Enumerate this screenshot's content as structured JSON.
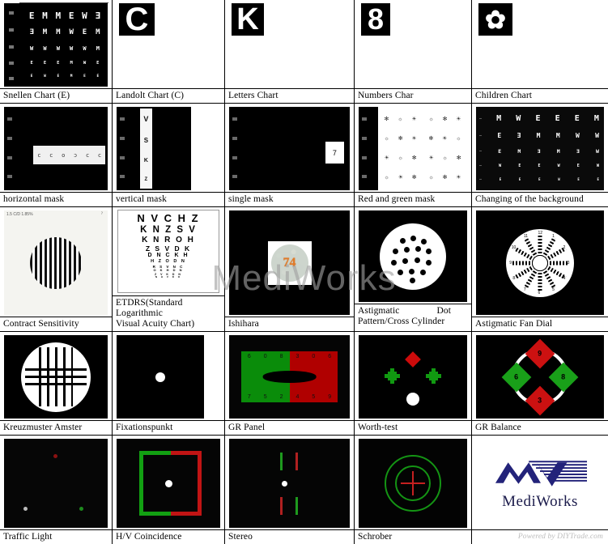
{
  "brand": {
    "name": "MediWorks",
    "watermark": "MediWorks",
    "powered_by": "Powered by DIYTrade.com",
    "logo_color": "#23237a"
  },
  "grid": {
    "columns": 5,
    "rows": 5,
    "cells": [
      {
        "caption": "Snellen Chart (E)",
        "art": "snellen-e-chart",
        "glyph": "E"
      },
      {
        "caption": "Landolt Chart (C)",
        "art": "landolt-c-tile",
        "glyph": "C"
      },
      {
        "caption": "Letters Chart",
        "art": "letter-tile",
        "glyph": "K"
      },
      {
        "caption": "Numbers Char",
        "art": "number-tile",
        "glyph": "8"
      },
      {
        "caption": "Children Chart",
        "art": "children-symbol-tile",
        "glyph": "✿"
      },
      {
        "caption": "horizontal mask",
        "art": "horizontal-mask"
      },
      {
        "caption": "vertical mask",
        "art": "vertical-mask"
      },
      {
        "caption": "single mask",
        "art": "single-mask"
      },
      {
        "caption": "Red and green mask",
        "art": "red-green-mask"
      },
      {
        "caption": "Changing of the background",
        "art": "changing-background"
      },
      {
        "caption": "Contract Sensitivity",
        "art": "contrast-sensitivity-grating"
      },
      {
        "caption": "ETDRS(Standard",
        "caption2": "Logarithmic",
        "caption3": "Visual Acuity Chart)",
        "art": "etdrs-chart"
      },
      {
        "caption": "Ishihara",
        "art": "ishihara-plate"
      },
      {
        "caption": "Astigmatic",
        "caption2": "Dot",
        "caption3": "Pattern/Cross Cylinder",
        "art": "astigmatic-dot-pattern"
      },
      {
        "caption": "Astigmatic Fan Dial",
        "art": "astigmatic-fan-dial"
      },
      {
        "caption": "Kreuzmuster Amster",
        "art": "kreuzmuster-amsler"
      },
      {
        "caption": "Fixationspunkt",
        "art": "fixation-point"
      },
      {
        "caption": "GR Panel",
        "art": "red-green-panel"
      },
      {
        "caption": "Worth-test",
        "art": "worth-four-dot"
      },
      {
        "caption": "GR Balance",
        "art": "red-green-balance"
      },
      {
        "caption": "Traffic Light",
        "art": "traffic-light"
      },
      {
        "caption": "H/V Coincidence",
        "art": "hv-coincidence"
      },
      {
        "caption": "Stereo",
        "art": "stereo-test"
      },
      {
        "caption": "Schrober",
        "art": "schober-test"
      },
      {
        "caption": "",
        "art": "mediworks-logo"
      }
    ]
  },
  "snellen": {
    "rows": [
      [
        "E",
        "M",
        "M",
        "E",
        "W",
        "Ǝ"
      ],
      [
        "Ǝ",
        "M",
        "M",
        "W",
        "E",
        "M"
      ],
      [
        "W",
        "W",
        "W",
        "W",
        "W",
        "M"
      ],
      [
        "E",
        "E",
        "E",
        "M",
        "W",
        "E"
      ],
      [
        "E",
        "W",
        "E",
        "M",
        "E",
        "E"
      ]
    ]
  },
  "vertical_mask": {
    "letters": [
      "V",
      "S",
      "K",
      "Z"
    ]
  },
  "single_mask": {
    "letter": "7"
  },
  "changing_background": {
    "rows": [
      [
        "M",
        "W",
        "E",
        "E",
        "E",
        "M"
      ],
      [
        "E",
        "Ǝ",
        "M",
        "M",
        "W",
        "W"
      ],
      [
        "E",
        "M",
        "Ǝ",
        "M",
        "Ǝ",
        "W"
      ],
      [
        "W",
        "E",
        "E",
        "W",
        "E",
        "W"
      ],
      [
        "E",
        "E",
        "E",
        "W",
        "E",
        "E"
      ]
    ]
  },
  "contrast_sensitivity": {
    "label": "1.5 C/D 1.85%",
    "corner_mark": "?"
  },
  "etdrs": {
    "lines": [
      "N V C H Z",
      "K N Z S V",
      "K N R O H",
      "Z S V D K",
      "D N C K H",
      "H Z O D N",
      "R S V N C",
      "O K H D N",
      "Z V K D N",
      "N H V D O"
    ]
  },
  "ishihara": {
    "number": "74"
  },
  "fan_dial": {
    "numbers": [
      "12",
      "1",
      "2",
      "3",
      "4",
      "5",
      "6",
      "7",
      "8",
      "9",
      "10",
      "11"
    ]
  },
  "gr_panel": {
    "green_top": [
      "6",
      "0",
      "8"
    ],
    "green_bottom": [
      "7",
      "5",
      "2"
    ],
    "red_top": [
      "3",
      "0",
      "6"
    ],
    "red_bottom": [
      "4",
      "5",
      "9"
    ],
    "green_color": "#0a8c0a",
    "red_color": "#b00000"
  },
  "gr_balance": {
    "top": "9",
    "bottom": "3",
    "left": "6",
    "right": "8",
    "green_color": "#19a019",
    "red_color": "#cc1111"
  },
  "colors": {
    "black": "#000000",
    "white": "#ffffff",
    "green": "#0a8c0a",
    "red": "#b00000",
    "border": "#000000",
    "watermark": "#a0a0a0",
    "powered_text": "#bdbdbd"
  }
}
